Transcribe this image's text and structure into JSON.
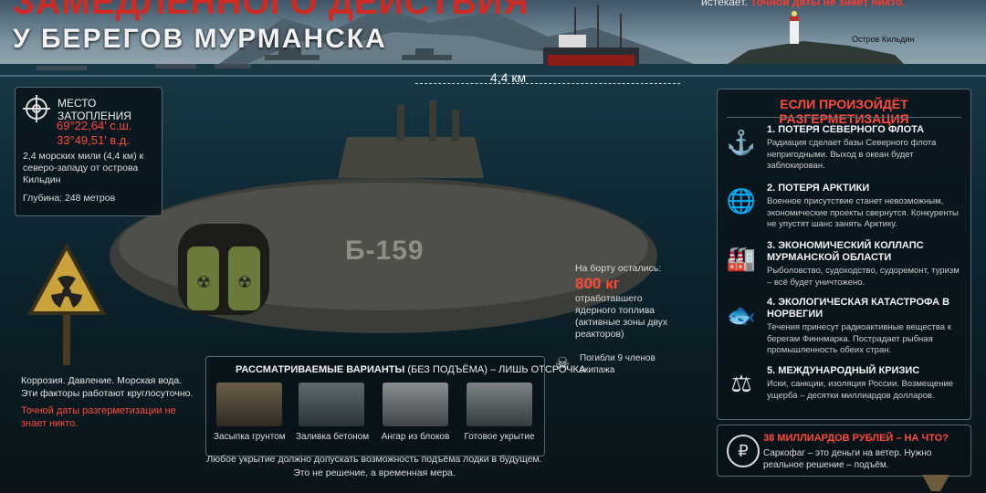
{
  "header": {
    "title_line1": "ЗАМЕДЛЕННОГО ДЕЙСТВИЯ",
    "title_line2": "У БЕРЕГОВ МУРМАНСКА",
    "top_note_prefix": "истекает.",
    "top_note_red": "Точной даты не знает никто."
  },
  "scene": {
    "island_label": "Остров Кильдин",
    "distance": "4,4 км",
    "hull_number": "Б-159"
  },
  "location": {
    "title": "МЕСТО ЗАТОПЛЕНИЯ",
    "lat": "69°22,64' с.ш.",
    "lon": "33°49,51' в.д.",
    "description": "2,4 морских мили (4,4 км) к северо-западу от острова Кильдин",
    "depth": "Глубина: 248 метров"
  },
  "left_note": {
    "text": "Коррозия. Давление. Морская вода. Эти факторы работают круглосуточно.",
    "red": "Точной даты разгерметизации не знает никто."
  },
  "onboard": {
    "label": "На борту остались:",
    "amount": "800 кг",
    "description": "отработавшего ядерного топлива (активные зоны двух реакторов)"
  },
  "crew": {
    "text": "Погибли 9 членов экипажа"
  },
  "options": {
    "title_bold": "РАССМАТРИВАЕМЫЕ ВАРИАНТЫ",
    "title_rest": "(БЕЗ ПОДЪЁМА) – ЛИШЬ ОТСРОЧКА",
    "items": [
      {
        "label": "Засыпка грунтом"
      },
      {
        "label": "Заливка бетоном"
      },
      {
        "label": "Ангар из блоков"
      },
      {
        "label": "Готовое укрытие"
      }
    ],
    "footer_1": "Любое укрытие должно допускать возможность подъёма лодки в будущем.",
    "footer_2": "Это не решение, а временная мера."
  },
  "risks": {
    "title": "ЕСЛИ ПРОИЗОЙДЁТ РАЗГЕРМЕТИЗАЦИЯ",
    "items": [
      {
        "icon": "anchor-icon",
        "head": "1. ПОТЕРЯ СЕВЕРНОГО ФЛОТА",
        "text": "Радиация сделает базы Северного флота непригодными. Выход в океан будет заблокирован."
      },
      {
        "icon": "globe-icon",
        "head": "2. ПОТЕРЯ АРКТИКИ",
        "text": "Военное присутствие станет невозможным, экономические проекты свернутся. Конкуренты не упустят шанс занять Арктику."
      },
      {
        "icon": "factory-icon",
        "head": "3. ЭКОНОМИЧЕСКИЙ КОЛЛАПС МУРМАНСКОЙ ОБЛАСТИ",
        "text": "Рыболовство, судоходство, судоремонт, туризм – всё будет уничтожено."
      },
      {
        "icon": "fish-icon",
        "head": "4. ЭКОЛОГИЧЕСКАЯ КАТАСТРОФА В НОРВЕГИИ",
        "text": "Течения принесут радиоактивные вещества к берегам Финнмарка. Пострадает рыбная промышленность обеих стран."
      },
      {
        "icon": "gavel-icon",
        "head": "5. МЕЖДУНАРОДНЫЙ КРИЗИС",
        "text": "Иски, санкции, изоляция России. Возмещение ущерба – десятки миллиардов долларов."
      }
    ]
  },
  "cost": {
    "title": "38 МИЛЛИАРДОВ РУБЛЕЙ – НА ЧТО?",
    "text": "Саркофаг – это деньги на ветер. Нужно реальное решение – подъём.",
    "icon": "ruble-icon"
  }
}
